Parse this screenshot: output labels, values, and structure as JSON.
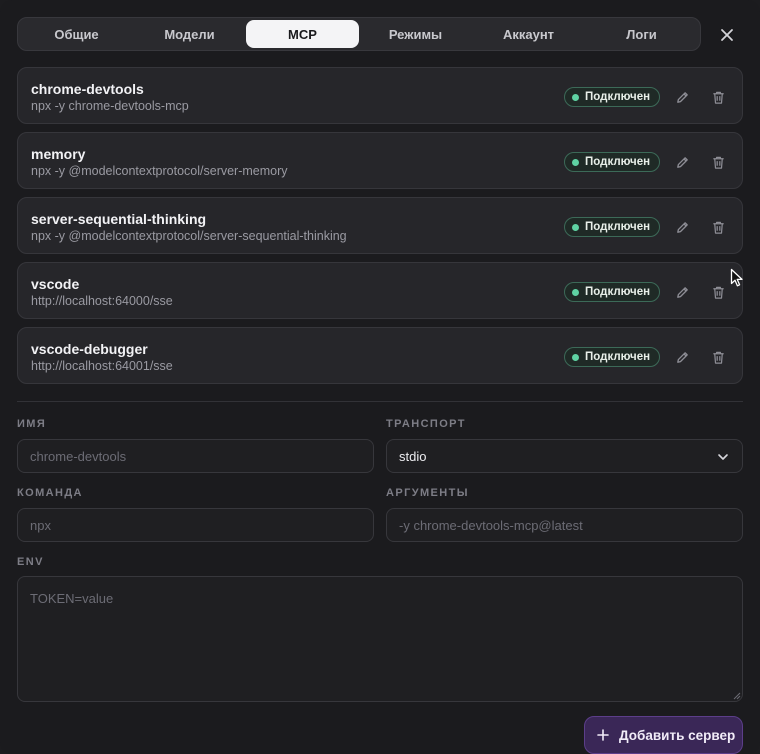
{
  "tabs": [
    {
      "label": "Общие",
      "active": false
    },
    {
      "label": "Модели",
      "active": false
    },
    {
      "label": "MCP",
      "active": true
    },
    {
      "label": "Режимы",
      "active": false
    },
    {
      "label": "Аккаунт",
      "active": false
    },
    {
      "label": "Логи",
      "active": false
    }
  ],
  "icons": {
    "close": "close-icon",
    "edit": "pencil-icon",
    "delete": "trash-icon",
    "select": "chevron-down-icon",
    "add": "plus-icon"
  },
  "servers": [
    {
      "name": "chrome-devtools",
      "command": "npx -y chrome-devtools-mcp",
      "status": "Подключен"
    },
    {
      "name": "memory",
      "command": "npx -y @modelcontextprotocol/server-memory",
      "status": "Подключен"
    },
    {
      "name": "server-sequential-thinking",
      "command": "npx -y @modelcontextprotocol/server-sequential-thinking",
      "status": "Подключен"
    },
    {
      "name": "vscode",
      "command": "http://localhost:64000/sse",
      "status": "Подключен"
    },
    {
      "name": "vscode-debugger",
      "command": "http://localhost:64001/sse",
      "status": "Подключен"
    }
  ],
  "form": {
    "name_label": "ИМЯ",
    "name_placeholder": "chrome-devtools",
    "transport_label": "ТРАНСПОРТ",
    "transport_value": "stdio",
    "command_label": "КОМАНДА",
    "command_placeholder": "npx",
    "args_label": "АРГУМЕНТЫ",
    "args_placeholder": "-y chrome-devtools-mcp@latest",
    "env_label": "ENV",
    "env_placeholder": "TOKEN=value"
  },
  "add_button_label": "Добавить сервер",
  "colors": {
    "accent": "#3a2757",
    "status_dot": "#5fd3a3",
    "active_tab": "#f4f4f6"
  }
}
